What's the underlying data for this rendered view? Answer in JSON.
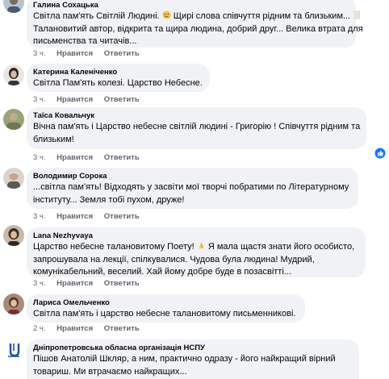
{
  "comments": [
    {
      "author": "Галина Сохацька",
      "lines": [
        "Світла пам'ять Світлій Людині.",
        " Щирі слова співчуття рідним та близьким...",
        "Талановитий автор, відкрита та щира людина, добрий друг... Велика втрата для",
        "письменства та читачів..."
      ],
      "time": "3 ч.",
      "like": "Нравится",
      "reply": "Ответить"
    },
    {
      "author": "Катерина Каленіченко",
      "lines": [
        "Світла Пам'ять колезі. Царство Небесне."
      ],
      "time": "3 ч.",
      "like": "Нравится",
      "reply": "Ответить"
    },
    {
      "author": "Таїса Ковальчук",
      "lines": [
        "Вічна пам'ять і Царство небесне світлій людині - Григорію ! Співчуття рідним та",
        "близьким!"
      ],
      "time": "3 ч.",
      "like": "Нравится",
      "reply": "Ответить"
    },
    {
      "author": "Володимир Сорока",
      "lines": [
        "...світла пам'ять! Відходять у засвіти мої творчі побратими по Літературному",
        "інституту... Земля тобі пухом, друже!"
      ],
      "time": "3 ч.",
      "like": "Нравится",
      "reply": "Ответить"
    },
    {
      "author": "Lana Nezhyvaya",
      "lines": [
        "Царство небесне талановитому Поету!",
        " Я мала щастя знати його особисто,",
        "запрошувала на лекції, спілкувалися. Чудова була людина! Мудрий,",
        "комунікабельний, веселий. Хай йому добре буде в позасвітті..."
      ],
      "time": "3 ч.",
      "like": "Нравится",
      "reply": "Ответить"
    },
    {
      "author": "Лариса Омельченко",
      "lines": [
        "Світла пам'ять і царство небесне талановитому письменникові."
      ],
      "time": "2 ч.",
      "like": "Нравится",
      "reply": "Ответить"
    },
    {
      "author": "Дніпропетровська обласна організація НСПУ",
      "lines": [
        "Пішов Анатолій Шкляр, а ним, практично одразу - його найкращий вірний",
        "товариш. Ми втрачаємо найкращих..."
      ]
    }
  ],
  "icons": {
    "sad_emoji": "sad-face-emoji",
    "paper_emoji": "page-emoji",
    "pray_emoji": "folded-hands-emoji",
    "reaction": "thumbs-up-reaction"
  },
  "colors": {
    "bubble": "#f0f2f5",
    "meta_text": "#65676b",
    "like_blue": "#1877f2",
    "nspu_logo": "#1e4fa0"
  }
}
